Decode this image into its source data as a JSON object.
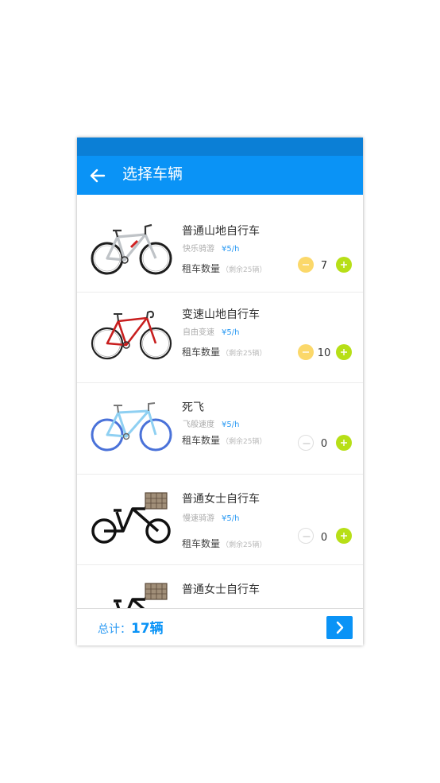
{
  "header": {
    "title": "选择车辆"
  },
  "vehicles": [
    {
      "name": "普通山地自行车",
      "tag": "快乐骑游",
      "price": "¥5/h",
      "qty_label": "租车数量",
      "remaining": "（剩余25辆）",
      "count": "7",
      "bike": "mountain-bike"
    },
    {
      "name": "变速山地自行车",
      "tag": "自由变速",
      "price": "¥5/h",
      "qty_label": "租车数量",
      "remaining": "（剩余25辆）",
      "count": "10",
      "bike": "road-bike"
    },
    {
      "name": "死飞",
      "tag": "飞般速度",
      "price": "¥5/h",
      "qty_label": "租车数量",
      "remaining": "（剩余25辆）",
      "count": "0",
      "bike": "fixed-gear-bike"
    },
    {
      "name": "普通女士自行车",
      "tag": "慢速骑游",
      "price": "¥5/h",
      "qty_label": "租车数量",
      "remaining": "（剩余25辆）",
      "count": "0",
      "bike": "basket-bike"
    },
    {
      "name": "普通女士自行车",
      "bike": "basket-bike"
    }
  ],
  "footer": {
    "total_label": "总计：",
    "total_count": "17辆"
  },
  "colors": {
    "accent": "#0a93f6",
    "statusbar": "#0b7fd6",
    "minus_active": "#fbd86a",
    "plus": "#b7df17"
  },
  "icons": {
    "back": "arrow-left-icon",
    "minus": "minus-icon",
    "plus": "plus-icon",
    "next": "chevron-right-icon"
  }
}
